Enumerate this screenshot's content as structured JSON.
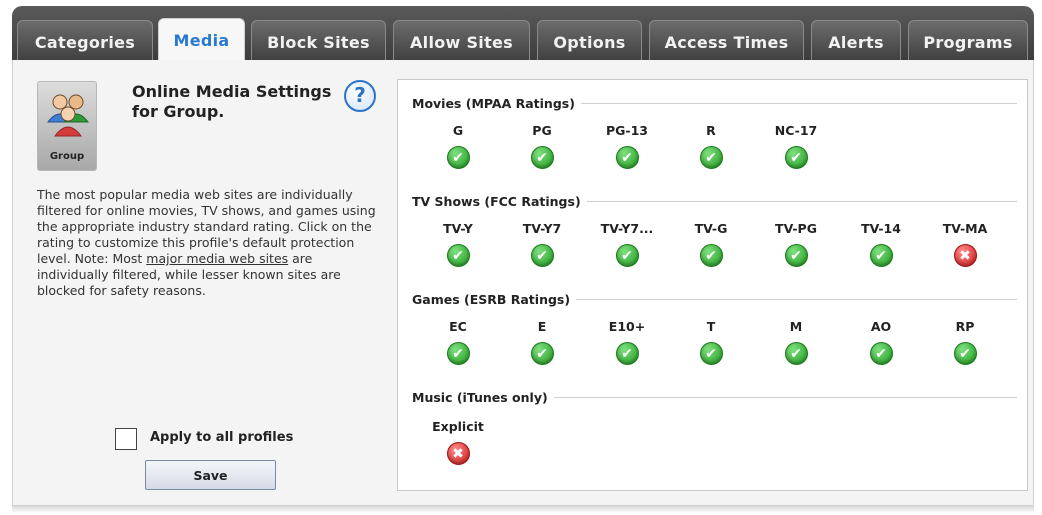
{
  "tabs": [
    {
      "label": "Categories",
      "active": false
    },
    {
      "label": "Media",
      "active": true
    },
    {
      "label": "Block Sites",
      "active": false
    },
    {
      "label": "Allow Sites",
      "active": false
    },
    {
      "label": "Options",
      "active": false
    },
    {
      "label": "Access Times",
      "active": false
    },
    {
      "label": "Alerts",
      "active": false
    },
    {
      "label": "Programs",
      "active": false
    }
  ],
  "profile": {
    "avatar_label": "Group",
    "avatar_icon": "group-icon"
  },
  "settings_title": "Online Media Settings for Group.",
  "help_icon": "?",
  "description": {
    "before_link": "The most popular media web sites are individually filtered for online movies, TV shows, and games using the appropriate industry standard rating.  Click on the rating to customize this profile's default protection level.  Note: Most ",
    "link": "major media web sites",
    "after_link": " are individually filtered, while lesser known sites are blocked for safety reasons."
  },
  "apply_all": {
    "label": "Apply to all profiles",
    "checked": false
  },
  "save_label": "Save",
  "status_symbols": {
    "allowed": "✔",
    "blocked": "✖"
  },
  "colors": {
    "allowed": "#2aa52a",
    "blocked": "#d81f1f",
    "active_tab_text": "#2a7bd0"
  },
  "sections": [
    {
      "title": "Movies (MPAA Ratings)",
      "ratings": [
        {
          "label": "G",
          "status": "allowed"
        },
        {
          "label": "PG",
          "status": "allowed"
        },
        {
          "label": "PG-13",
          "status": "allowed"
        },
        {
          "label": "R",
          "status": "allowed"
        },
        {
          "label": "NC-17",
          "status": "allowed"
        }
      ]
    },
    {
      "title": "TV Shows (FCC Ratings)",
      "ratings": [
        {
          "label": "TV-Y",
          "status": "allowed"
        },
        {
          "label": "TV-Y7",
          "status": "allowed"
        },
        {
          "label": "TV-Y7...",
          "status": "allowed"
        },
        {
          "label": "TV-G",
          "status": "allowed"
        },
        {
          "label": "TV-PG",
          "status": "allowed"
        },
        {
          "label": "TV-14",
          "status": "allowed"
        },
        {
          "label": "TV-MA",
          "status": "blocked"
        }
      ]
    },
    {
      "title": "Games (ESRB Ratings)",
      "ratings": [
        {
          "label": "EC",
          "status": "allowed"
        },
        {
          "label": "E",
          "status": "allowed"
        },
        {
          "label": "E10+",
          "status": "allowed"
        },
        {
          "label": "T",
          "status": "allowed"
        },
        {
          "label": "M",
          "status": "allowed"
        },
        {
          "label": "AO",
          "status": "allowed"
        },
        {
          "label": "RP",
          "status": "allowed"
        }
      ]
    },
    {
      "title": "Music (iTunes only)",
      "ratings": [
        {
          "label": "Explicit",
          "status": "blocked"
        }
      ]
    }
  ]
}
